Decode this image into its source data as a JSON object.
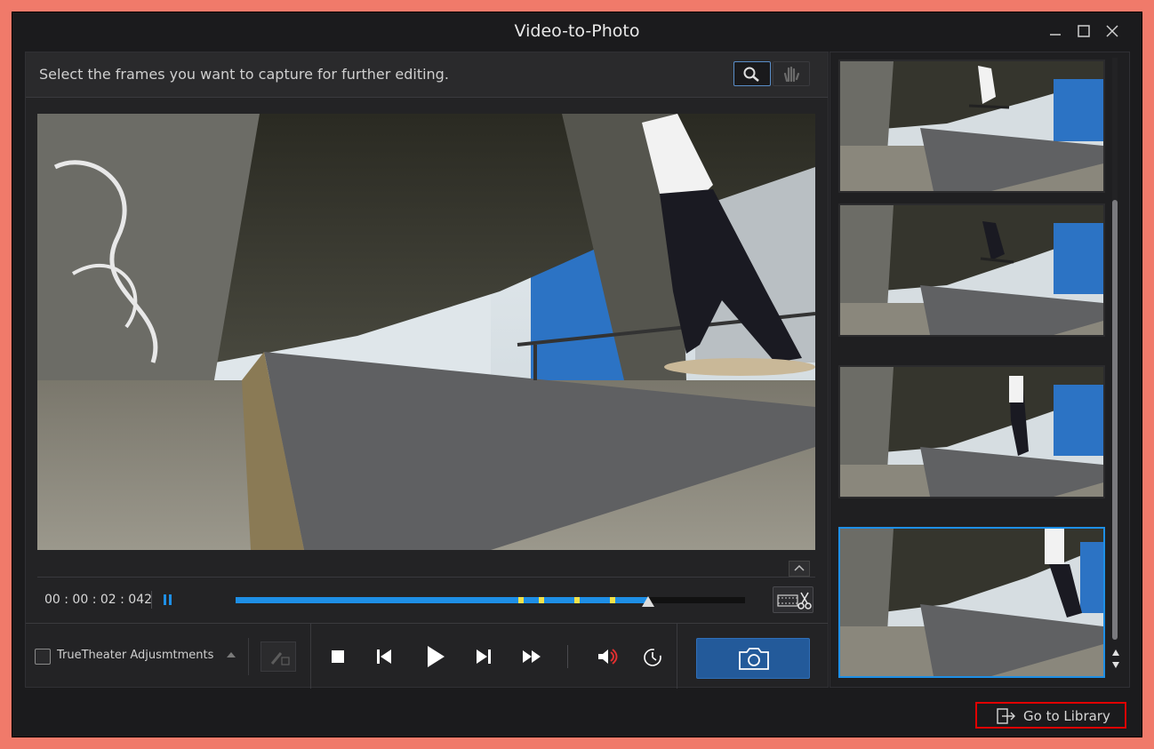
{
  "window": {
    "title": "Video-to-Photo",
    "controls": [
      "minimize-icon",
      "maximize-icon",
      "close-icon"
    ]
  },
  "preview": {
    "instruction": "Select the frames you want to capture for further editing.",
    "tools": [
      "magnifier-icon",
      "hand-icon"
    ]
  },
  "timeline": {
    "timecode": "00 : 00 : 02 : 042",
    "progress": 0.81,
    "markers": [
      0.56,
      0.6,
      0.67,
      0.74
    ]
  },
  "controls": {
    "truetheater_label": "TrueTheater Adjusmtments",
    "truetheater_checked": false
  },
  "frames": {
    "count": 4,
    "selected_index": 3
  },
  "footer": {
    "goto_library_label": "Go to Library"
  },
  "colors": {
    "accent": "#1e8fe6",
    "marker": "#f2e24a",
    "capture_button": "#235a9a",
    "highlight_box": "#e10000"
  }
}
